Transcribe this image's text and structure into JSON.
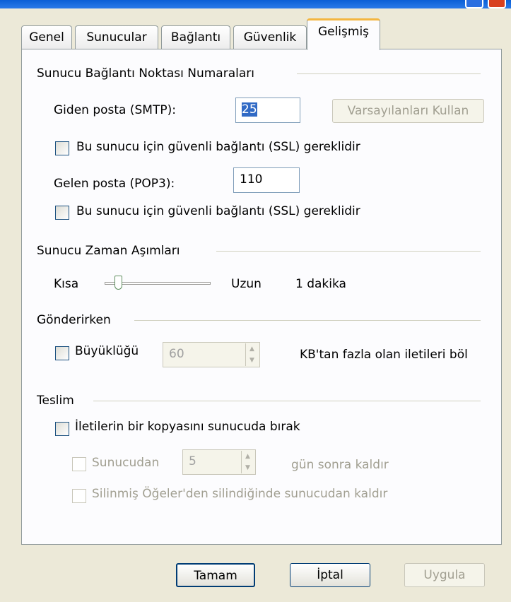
{
  "tabs": [
    "Genel",
    "Sunucular",
    "Bağlantı",
    "Güvenlik",
    "Gelişmiş"
  ],
  "groups": {
    "ports": "Sunucu Bağlantı Noktası Numaraları",
    "timeouts": "Sunucu Zaman Aşımları",
    "sending": "Gönderirken",
    "delivery": "Teslim"
  },
  "ports": {
    "smtp_label": "Giden posta (SMTP):",
    "smtp_value": "25",
    "defaults_button": "Varsayılanları Kullan",
    "smtp_ssl_label": "Bu sunucu için güvenli bağlantı (SSL) gereklidir",
    "pop3_label": "Gelen posta (POP3):",
    "pop3_value": "110",
    "pop3_ssl_label": "Bu sunucu için güvenli bağlantı (SSL) gereklidir"
  },
  "timeouts": {
    "short_label": "Kısa",
    "long_label": "Uzun",
    "value_text": "1 dakika",
    "slider_level": 0.1
  },
  "sending": {
    "size_label": "Büyüklüğü",
    "size_value": "60",
    "size_suffix": "KB'tan fazla olan iletileri böl"
  },
  "delivery": {
    "keep_copy_label": "İletilerin bir kopyasını sunucuda bırak",
    "remove_after_label": "Sunucudan",
    "remove_after_value": "5",
    "remove_after_suffix": "gün sonra kaldır",
    "remove_deleted_label": "Silinmiş Öğeler'den silindiğinde sunucudan kaldır"
  },
  "buttons": {
    "ok": "Tamam",
    "cancel": "İptal",
    "apply": "Uygula"
  }
}
